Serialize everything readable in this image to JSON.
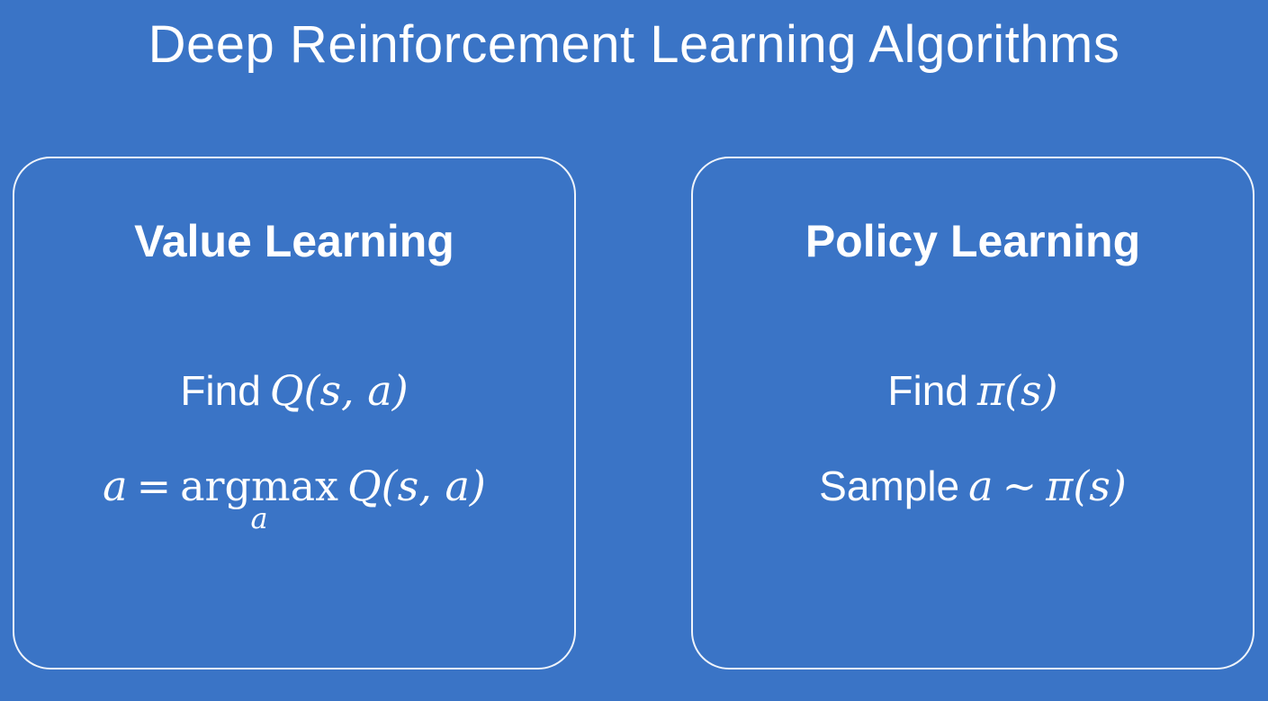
{
  "title": "Deep Reinforcement Learning Algorithms",
  "colors": {
    "background": "#3a74c6",
    "text": "#ffffff",
    "border": "#ffffff"
  },
  "value_learning": {
    "heading": "Value Learning",
    "find_label": "Find",
    "find_expr": "Q(s, a)",
    "action_var": "a",
    "equals": "=",
    "argmax": "argmax",
    "argmax_sub": "a",
    "argmax_expr": "Q(s, a)"
  },
  "policy_learning": {
    "heading": "Policy Learning",
    "find_label": "Find",
    "find_expr": "π(s)",
    "sample_label": "Sample",
    "sample_var": "a",
    "tilde": "~",
    "sample_expr": "π(s)"
  }
}
